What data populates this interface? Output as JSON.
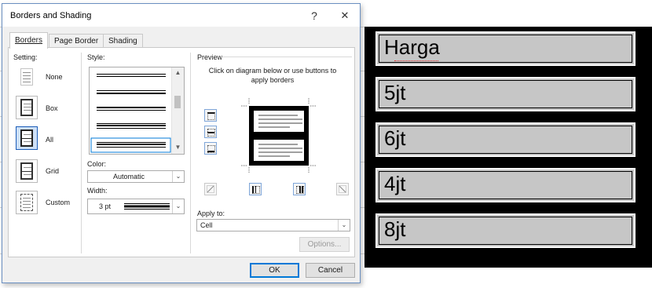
{
  "dialog": {
    "title": "Borders and Shading",
    "help_label": "?",
    "close_label": "✕",
    "tabs": [
      {
        "label": "Borders",
        "underline": "B"
      },
      {
        "label": "Page Border",
        "underline": "P"
      },
      {
        "label": "Shading",
        "underline": "S"
      }
    ],
    "setting": {
      "label": "Setting:",
      "items": [
        {
          "label": "None",
          "icon": "setting-none-icon",
          "selected": false
        },
        {
          "label": "Box",
          "icon": "setting-box-icon",
          "selected": false
        },
        {
          "label": "All",
          "icon": "setting-all-icon",
          "selected": true
        },
        {
          "label": "Grid",
          "icon": "setting-grid-icon",
          "selected": false
        },
        {
          "label": "Custom",
          "icon": "setting-custom-icon",
          "selected": false
        }
      ]
    },
    "style": {
      "label": "Style:",
      "selected_index": 4
    },
    "color": {
      "label": "Color:",
      "value": "Automatic"
    },
    "width": {
      "label": "Width:",
      "value": "3 pt"
    },
    "preview": {
      "label": "Preview",
      "hint": "Click on diagram below or use buttons to apply borders"
    },
    "apply_to": {
      "label": "Apply to:",
      "value": "Cell"
    },
    "options_label": "Options...",
    "ok_label": "OK",
    "cancel_label": "Cancel",
    "accent_color": "#0078d7"
  },
  "document": {
    "table_cells": [
      "Harga",
      "5jt",
      "6jt",
      "4jt",
      "8jt"
    ],
    "cell_fill": "#c6c6c6"
  }
}
